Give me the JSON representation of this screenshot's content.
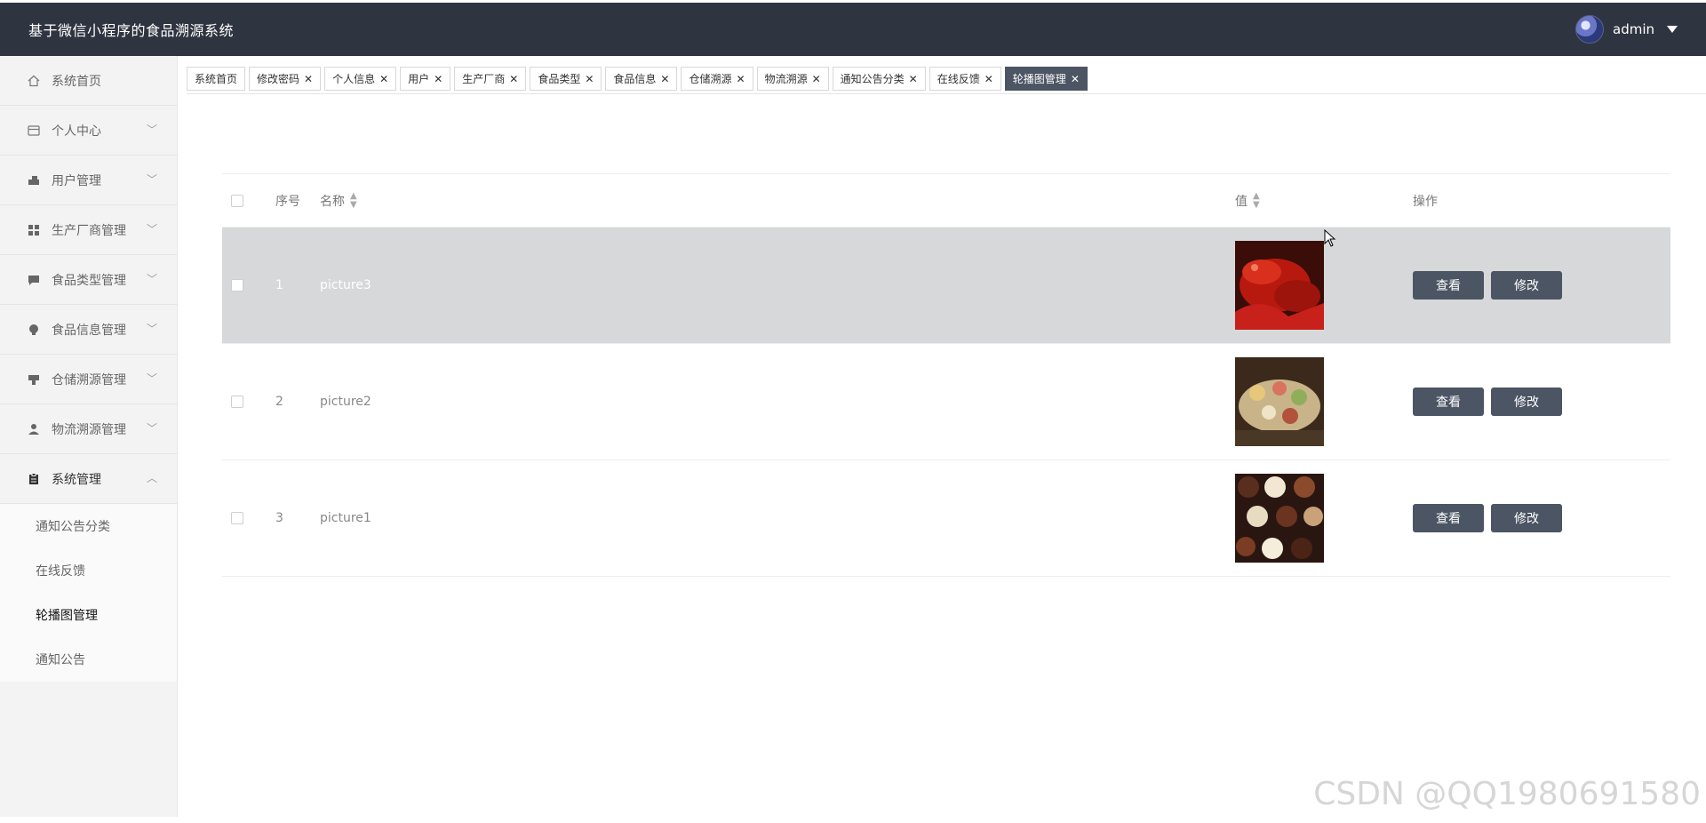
{
  "header": {
    "title": "基于微信小程序的食品溯源系统",
    "user": "admin"
  },
  "sidebar": {
    "items": [
      {
        "label": "系统首页",
        "icon": "home-icon"
      },
      {
        "label": "个人中心",
        "icon": "card-icon"
      },
      {
        "label": "用户管理",
        "icon": "users-icon"
      },
      {
        "label": "生产厂商管理",
        "icon": "grid-icon"
      },
      {
        "label": "食品类型管理",
        "icon": "chat-icon"
      },
      {
        "label": "食品信息管理",
        "icon": "bulb-icon"
      },
      {
        "label": "仓储溯源管理",
        "icon": "store-icon"
      },
      {
        "label": "物流溯源管理",
        "icon": "person-icon"
      },
      {
        "label": "系统管理",
        "icon": "clipboard-icon"
      }
    ],
    "sub_items": [
      "通知公告分类",
      "在线反馈",
      "轮播图管理",
      "通知公告"
    ]
  },
  "tabs": [
    {
      "label": "系统首页",
      "closable": false
    },
    {
      "label": "修改密码",
      "closable": true
    },
    {
      "label": "个人信息",
      "closable": true
    },
    {
      "label": "用户",
      "closable": true
    },
    {
      "label": "生产厂商",
      "closable": true
    },
    {
      "label": "食品类型",
      "closable": true
    },
    {
      "label": "食品信息",
      "closable": true
    },
    {
      "label": "仓储溯源",
      "closable": true
    },
    {
      "label": "物流溯源",
      "closable": true
    },
    {
      "label": "通知公告分类",
      "closable": true
    },
    {
      "label": "在线反馈",
      "closable": true
    },
    {
      "label": "轮播图管理",
      "closable": true
    }
  ],
  "table": {
    "headers": {
      "index": "序号",
      "name": "名称",
      "value": "值",
      "actions": "操作"
    },
    "rows": [
      {
        "index": "1",
        "name": "picture3",
        "image": "lobster"
      },
      {
        "index": "2",
        "name": "picture2",
        "image": "platter"
      },
      {
        "index": "3",
        "name": "picture1",
        "image": "chocolates"
      }
    ],
    "view_label": "查看",
    "edit_label": "修改"
  },
  "watermark": "CSDN @QQ1980691580",
  "colors": {
    "header_bg": "#2f3540",
    "accent": "#4b5563",
    "row_highlight": "#d6d8da"
  }
}
